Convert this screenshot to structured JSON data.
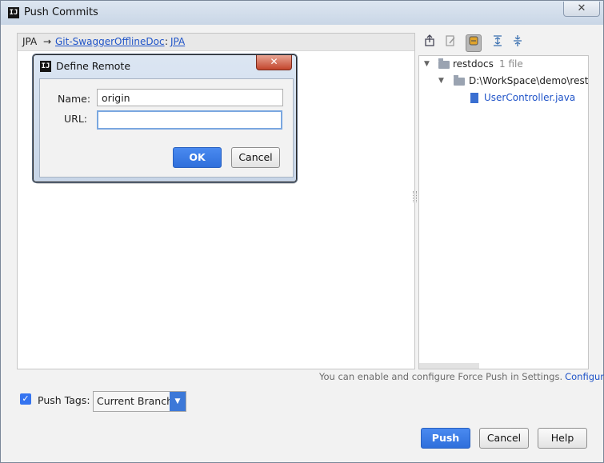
{
  "window": {
    "title": "Push Commits",
    "close_glyph": "✕",
    "app_icon": "IJ"
  },
  "branch": {
    "local": "JPA",
    "arrow": "→",
    "remote": "Git-SwaggerOfflineDoc",
    "separator": ":",
    "target": "JPA"
  },
  "toolbar": {
    "icons": [
      "vcs-push-icon",
      "edit-source-icon",
      "group-by-module-icon",
      "expand-all-icon",
      "collapse-all-icon"
    ]
  },
  "tree": {
    "root": {
      "label": "restdocs",
      "count": "1 file"
    },
    "folder": {
      "label": "D:\\WorkSpace\\demo\\rest"
    },
    "file": {
      "label": "UserController.java"
    }
  },
  "force_push": {
    "note": "You can enable and configure Force Push in Settings.",
    "configure_link": "Configure"
  },
  "push_tags": {
    "checked": true,
    "label": "Push Tags:",
    "selected": "Current Branch"
  },
  "buttons": {
    "push": "Push",
    "cancel": "Cancel",
    "help": "Help"
  },
  "dialog": {
    "title": "Define Remote",
    "name_label": "Name:",
    "name_value": "origin",
    "url_label": "URL:",
    "url_value": "",
    "ok": "OK",
    "cancel": "Cancel",
    "close_glyph": "✕"
  },
  "colors": {
    "accent": "#3574f0",
    "link": "#2054c8",
    "close_red": "#c3452c"
  }
}
